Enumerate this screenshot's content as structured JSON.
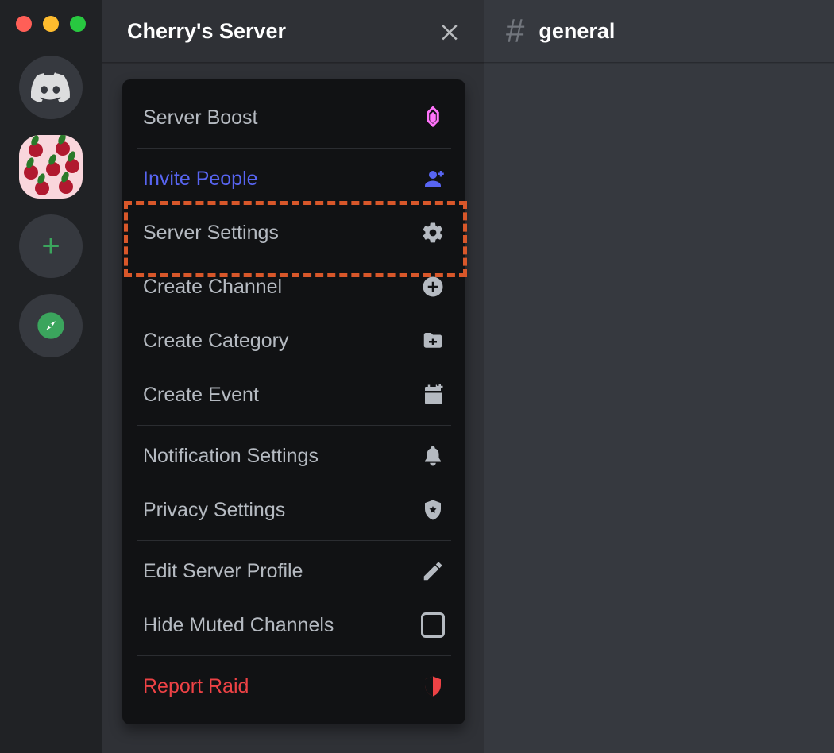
{
  "server": {
    "name": "Cherry's Server"
  },
  "channel": {
    "name": "general"
  },
  "menu": {
    "server_boost": "Server Boost",
    "invite_people": "Invite People",
    "server_settings": "Server Settings",
    "create_channel": "Create Channel",
    "create_category": "Create Category",
    "create_event": "Create Event",
    "notification_settings": "Notification Settings",
    "privacy_settings": "Privacy Settings",
    "edit_server_profile": "Edit Server Profile",
    "hide_muted_channels": "Hide Muted Channels",
    "report_raid": "Report Raid"
  },
  "rail": {
    "home_icon": "discord-logo-icon",
    "server_icon": "cherry-server-icon",
    "add_server_icon": "plus-icon",
    "explore_icon": "compass-icon"
  },
  "annotation": {
    "target": "server_settings"
  }
}
